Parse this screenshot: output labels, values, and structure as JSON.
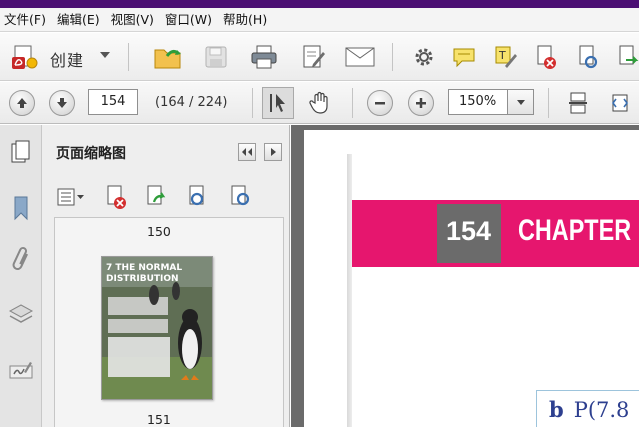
{
  "menu": {
    "items": [
      "文件(F)",
      "编辑(E)",
      "视图(V)",
      "窗口(W)",
      "帮助(H)"
    ]
  },
  "toolbar": {
    "create_label": "创建"
  },
  "navigation": {
    "current_page": "154",
    "page_count": "(164 / 224)",
    "zoom": "150%"
  },
  "thumbnail_panel": {
    "title": "页面缩略图",
    "thumbnails": [
      {
        "page_label": "150",
        "heading": "7 THE NORMAL DISTRIBUTION"
      },
      {
        "page_label": "151"
      }
    ]
  },
  "document": {
    "chapter_number": "154",
    "chapter_title": "CHAPTER",
    "answer_label": "b",
    "answer_text": "P(7.8"
  },
  "colors": {
    "title_bar": "#4b0f73",
    "chapter_band": "#e6166e",
    "answer_ink": "#2d3f8f"
  },
  "icons": {
    "toolbar_primary": [
      "create-pdf-icon",
      "open-folder-icon",
      "save-icon",
      "print-icon",
      "edit-document-icon",
      "email-icon",
      "gear-icon",
      "comment-icon",
      "highlight-icon",
      "delete-page-icon",
      "rotate-page-icon",
      "export-icon"
    ],
    "toolbar_secondary": [
      "previous-page-icon",
      "next-page-icon",
      "select-tool-icon",
      "hand-tool-icon",
      "zoom-out-icon",
      "zoom-in-icon",
      "fit-page-icon",
      "fit-width-icon"
    ],
    "sidebar": [
      "page-thumbnails-icon",
      "bookmark-icon",
      "attachment-icon",
      "layers-icon",
      "signature-icon"
    ]
  }
}
